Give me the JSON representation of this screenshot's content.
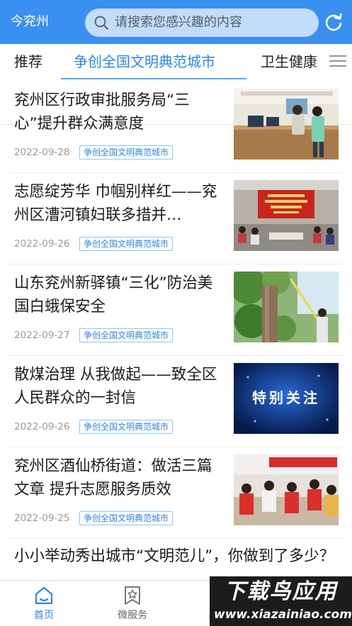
{
  "header": {
    "city": "今兖州",
    "search_placeholder": "请搜索您感兴趣的内容",
    "accent": "#3a90f0"
  },
  "tabs": [
    {
      "label": "推荐",
      "active": false
    },
    {
      "label": "争创全国文明典范城市",
      "active": true
    },
    {
      "label": "卫生健康",
      "active": false
    }
  ],
  "news": [
    {
      "title": "兖州区行政审批服务局“三心”提升群众满意度",
      "date": "2022-09-28",
      "tag": "争创全国文明典范城市"
    },
    {
      "title": "志愿绽芳华 巾帼别样红——兖州区漕河镇妇联多措并…",
      "date": "2022-09-26",
      "tag": "争创全国文明典范城市"
    },
    {
      "title": "山东兖州新驿镇“三化”防治美国白蛾保安全",
      "date": "2022-09-27",
      "tag": "争创全国文明典范城市"
    },
    {
      "title": "散煤治理 从我做起——致全区人民群众的一封信",
      "date": "2022-09-26",
      "tag": "争创全国文明典范城市"
    },
    {
      "title": "兖州区酒仙桥街道：做活三篇文章 提升志愿服务质效",
      "date": "2022-09-25",
      "tag": "争创全国文明典范城市"
    }
  ],
  "last_news": {
    "title": "小小举动秀出城市“文明范儿”，你做到了多少？"
  },
  "thumb_texts": {
    "special_attention": "特别关注"
  },
  "bottom_nav": [
    {
      "label": "首页",
      "active": true,
      "icon": "home-icon"
    },
    {
      "label": "微服务",
      "active": false,
      "icon": "star-badge-icon"
    }
  ],
  "watermark": {
    "main": "下载鸟应用",
    "url": "www.xiazainiao.com"
  }
}
